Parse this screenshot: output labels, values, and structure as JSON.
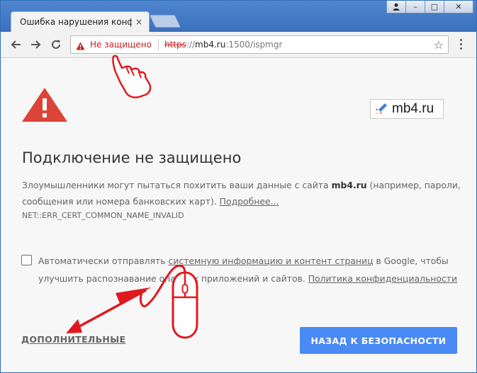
{
  "tab": {
    "title": "Ошибка нарушения конфиденциальности",
    "close": "×"
  },
  "window": {
    "minimize": "–",
    "maximize": "□",
    "close": "✕"
  },
  "omnibox": {
    "security_label": "Не защищено",
    "scheme": "https",
    "separator": "://",
    "host": "mb4.ru",
    "path": ":1500/ispmgr",
    "star": "☆"
  },
  "logo": {
    "text": "mb4.ru"
  },
  "page": {
    "headline": "Подключение не защищено",
    "body_part1": "Злоумышленники могут пытаться похитить ваши данные с сайта ",
    "body_host": "mb4.ru",
    "body_part2": " (например, пароли, сообщения или номера банковских карт). ",
    "more_link": "Подробнее...",
    "error_code": "NET::ERR_CERT_COMMON_NAME_INVALID",
    "check_part1": "Автоматически отправлять ",
    "check_link": "системную информацию и контент страниц",
    "check_part2": " в Google, чтобы улучшить распознавание опасных приложений и сайтов. ",
    "privacy_link": "Политика конфиденциальности",
    "advanced_button": "ДОПОЛНИТЕЛЬНЫЕ",
    "back_button": "НАЗАД К БЕЗОПАСНОСТИ"
  },
  "colors": {
    "insecure_red": "#c5221f",
    "button_blue": "#4a8af4",
    "annotation_red": "#e0191f",
    "warning_red": "#db4437"
  },
  "icons": [
    "back-arrow-icon",
    "forward-arrow-icon",
    "reload-icon",
    "warning-icon",
    "star-icon",
    "menu-icon",
    "pointing-hand-icon",
    "mouse-icon",
    "arrow-icon"
  ]
}
